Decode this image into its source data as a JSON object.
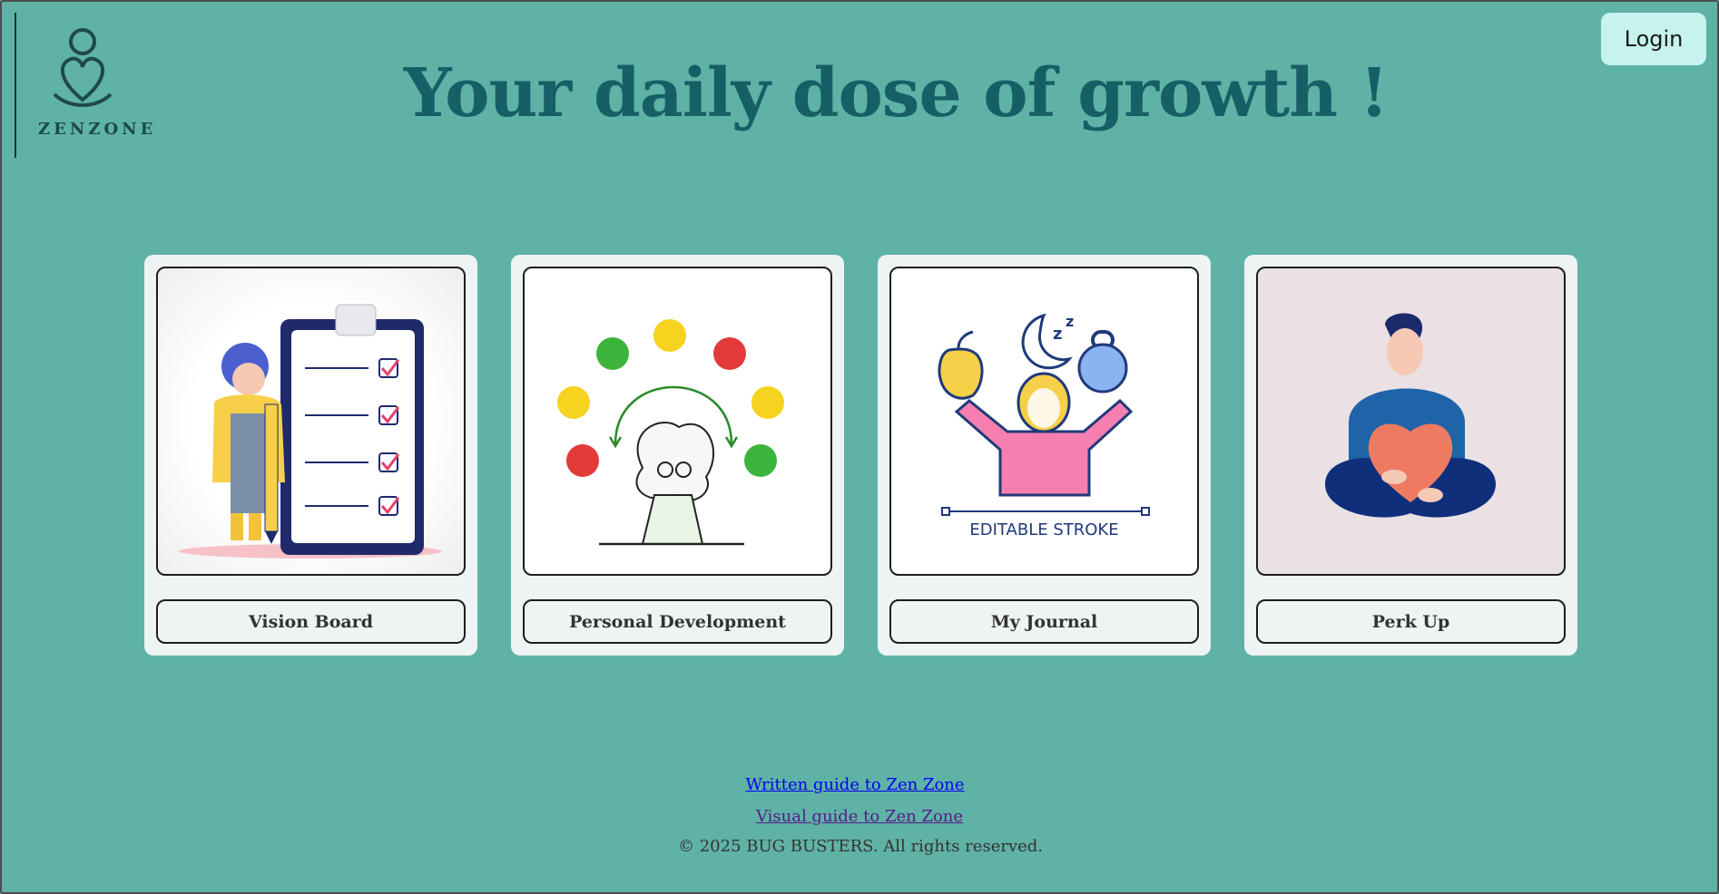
{
  "brand": {
    "name": "ZENZONE"
  },
  "header": {
    "title": "Your daily dose of growth !",
    "login_label": "Login"
  },
  "cards": [
    {
      "label": "Vision Board",
      "image": "checklist-illustration"
    },
    {
      "label": "Personal Development",
      "image": "emotions-illustration"
    },
    {
      "label": "My Journal",
      "image": "wellness-illustration",
      "image_text": "EDITABLE STROKE"
    },
    {
      "label": "Perk Up",
      "image": "meditation-heart-illustration"
    }
  ],
  "footer": {
    "written_guide": "Written guide to Zen Zone",
    "visual_guide": "Visual guide to Zen Zone",
    "copyright": "© 2025 BUG BUSTERS. All rights reserved."
  },
  "colors": {
    "background": "#5fb2a6",
    "title": "#175f66",
    "login_bg": "#c6f3ee",
    "card_bg": "#eef3f3"
  }
}
